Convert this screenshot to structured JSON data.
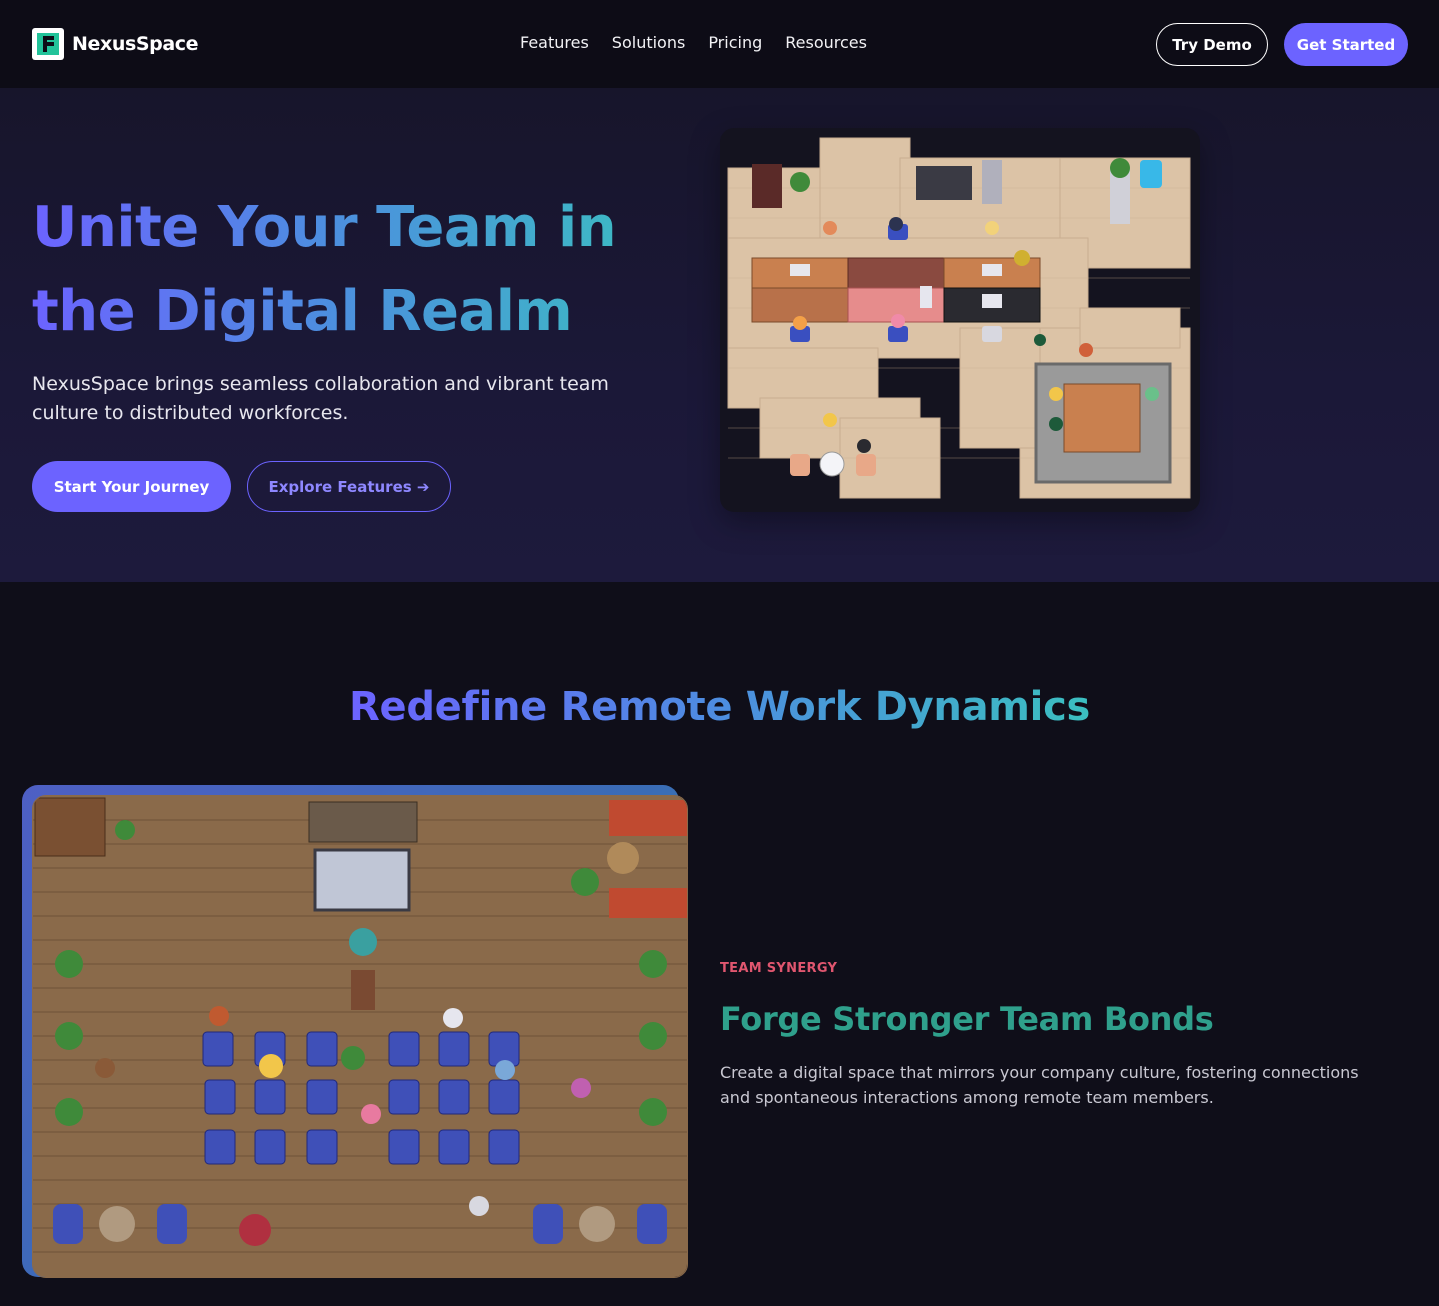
{
  "brand": {
    "name": "NexusSpace"
  },
  "nav": {
    "links": [
      "Features",
      "Solutions",
      "Pricing",
      "Resources"
    ],
    "try_demo": "Try Demo",
    "get_started": "Get Started"
  },
  "hero": {
    "title_line1": "Unite Your Team in",
    "title_line2": "the Digital Realm",
    "subtitle": "NexusSpace brings seamless collaboration and vibrant team culture to distributed workforces.",
    "primary_cta": "Start Your Journey",
    "secondary_cta": "Explore Features ➔"
  },
  "section": {
    "title": "Redefine Remote Work Dynamics"
  },
  "feature": {
    "eyebrow": "TEAM SYNERGY",
    "title": "Forge Stronger Team Bonds",
    "description": "Create a digital space that mirrors your company culture, fostering connections and spontaneous interactions among remote team members."
  },
  "colors": {
    "accent": "#6c63ff",
    "gradient_start": "#6c63ff",
    "gradient_end": "#3bbfc0",
    "eyebrow": "#e0566f",
    "feature_title": "#2fa08c"
  }
}
